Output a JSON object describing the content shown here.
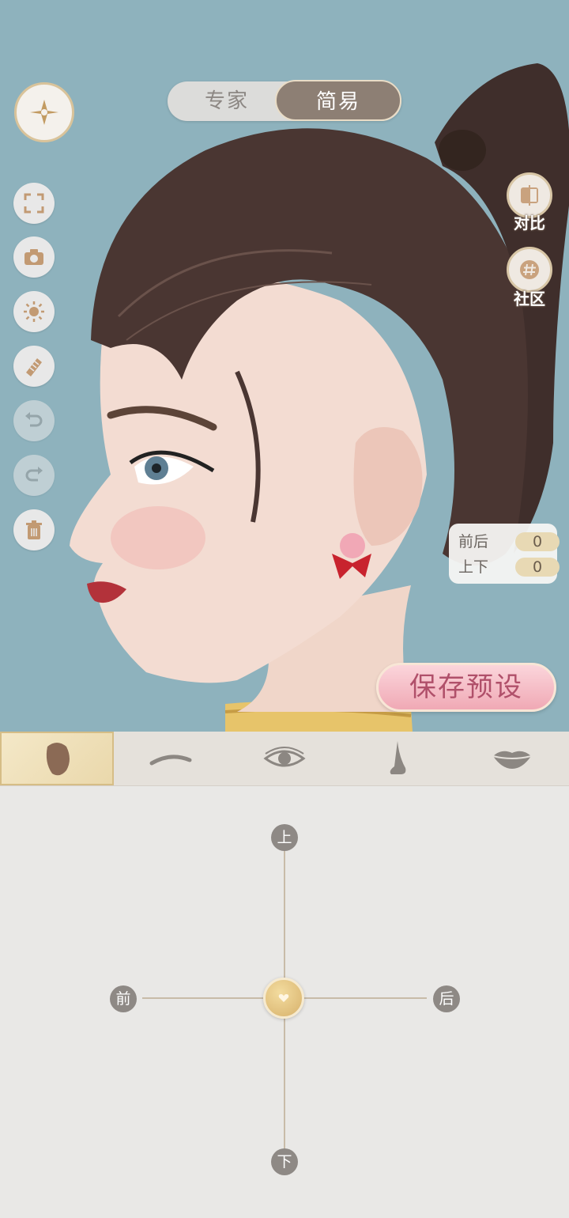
{
  "mode_toggle": {
    "expert": "专家",
    "simple": "简易",
    "selected": "简易"
  },
  "left_toolbar": [
    "fullscreen-icon",
    "camera-icon",
    "brightness-icon",
    "comb-icon",
    "undo-icon",
    "redo-icon",
    "trash-icon"
  ],
  "right_buttons": {
    "compare_label": "对比",
    "community_label": "社区"
  },
  "offset_panel": {
    "rows": [
      {
        "label": "前后",
        "value": "0"
      },
      {
        "label": "上下",
        "value": "0"
      }
    ]
  },
  "save_preset_label": "保存预设",
  "feature_tabs": [
    "face-icon",
    "eyebrow-icon",
    "eye-icon",
    "nose-icon",
    "lips-icon"
  ],
  "joystick": {
    "up": "上",
    "down": "下",
    "front": "前",
    "back": "后"
  },
  "colors": {
    "background": "#8eb2bd",
    "accent_gold": "#d7b16b",
    "save_pink": "#f0a9b5"
  }
}
